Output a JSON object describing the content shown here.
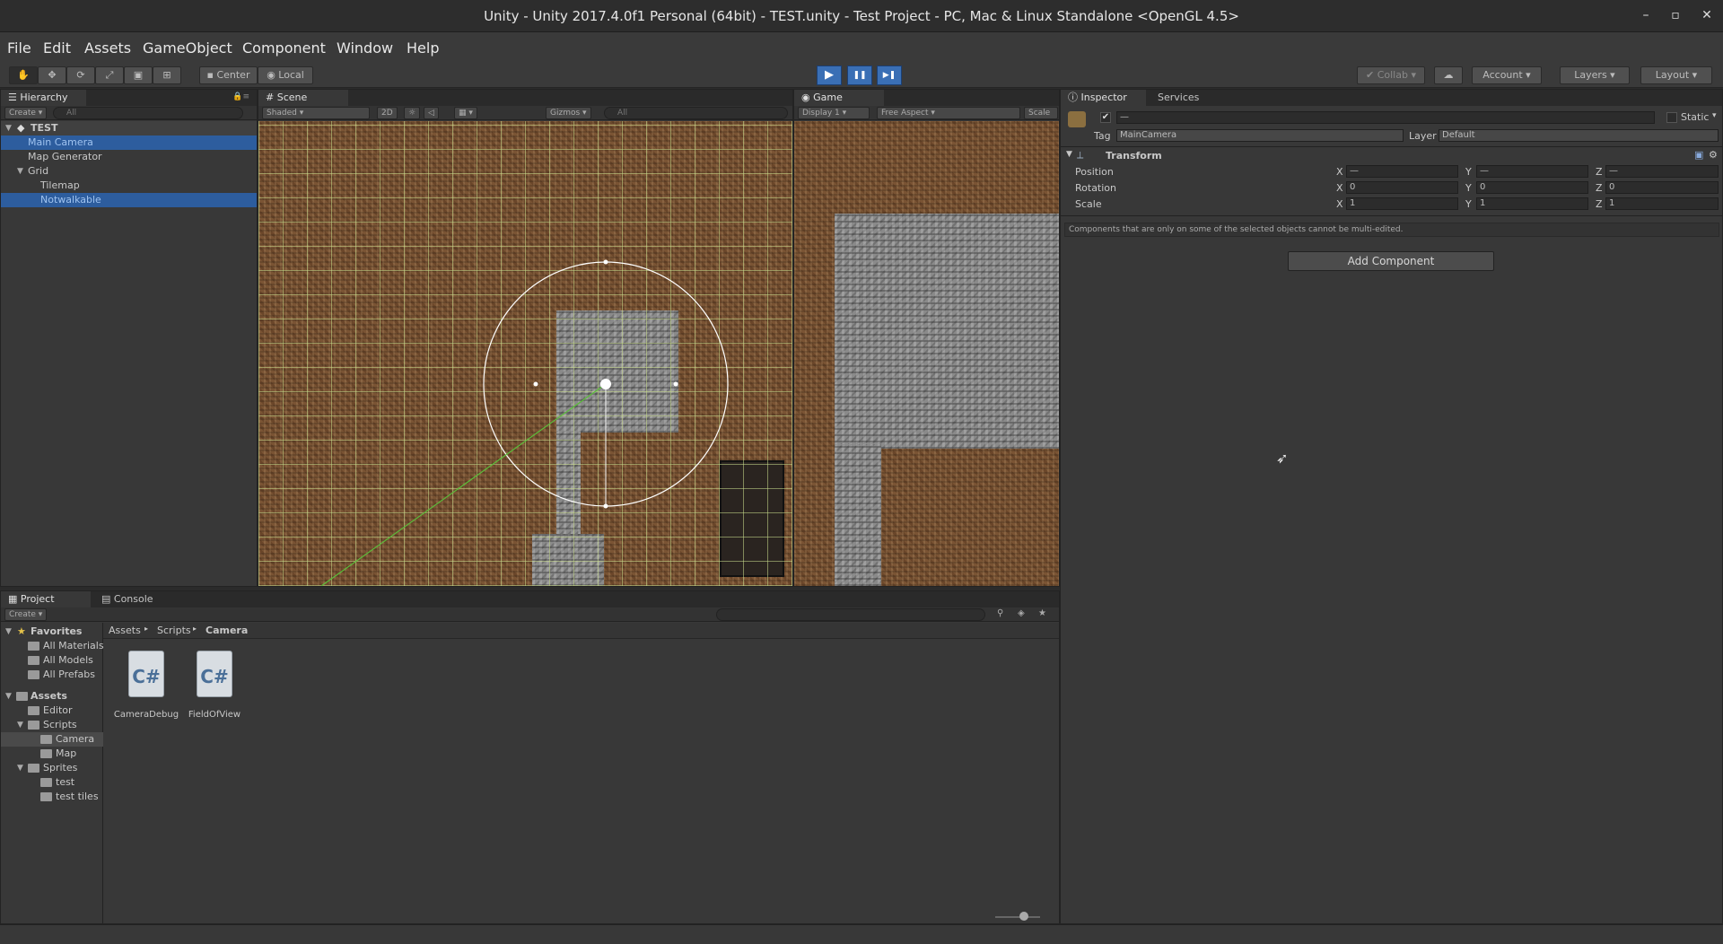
{
  "window": {
    "title": "Unity - Unity 2017.4.0f1 Personal (64bit) - TEST.unity - Test Project - PC, Mac & Linux Standalone <OpenGL 4.5>",
    "minimize": "–",
    "maximize": "▫",
    "close": "✕"
  },
  "menu": [
    "File",
    "Edit",
    "Assets",
    "GameObject",
    "Component",
    "Window",
    "Help"
  ],
  "toolbar": {
    "pivot": "Center",
    "space": "Local",
    "play": "▶",
    "pause": "❚❚",
    "step": "▶❚",
    "collab": "Collab",
    "account": "Account",
    "layers": "Layers",
    "layout": "Layout"
  },
  "hierarchy": {
    "tab": "Hierarchy",
    "create": "Create",
    "search_placeholder": "All",
    "scene": "TEST",
    "items": [
      {
        "label": "Main Camera",
        "selected": true
      },
      {
        "label": "Map Generator",
        "selected": false
      },
      {
        "label": "Grid",
        "selected": false
      },
      {
        "label": "Tilemap",
        "selected": false
      },
      {
        "label": "Notwalkable",
        "selected": true
      }
    ]
  },
  "scene": {
    "tab": "Scene",
    "shading": "Shaded",
    "mode2d": "2D",
    "gizmos": "Gizmos",
    "search_placeholder": "All"
  },
  "game": {
    "tab": "Game",
    "display": "Display 1",
    "aspect": "Free Aspect",
    "scale": "Scale"
  },
  "inspector": {
    "tab": "Inspector",
    "services_tab": "Services",
    "name_value": "—",
    "static_label": "Static",
    "tag_label": "Tag",
    "tag_value": "MainCamera",
    "layer_label": "Layer",
    "layer_value": "Default",
    "transform_title": "Transform",
    "position_label": "Position",
    "rotation_label": "Rotation",
    "scale_label": "Scale",
    "axes": [
      "X",
      "Y",
      "Z"
    ],
    "position": [
      "—",
      "—",
      "—"
    ],
    "rotation": [
      "0",
      "0",
      "0"
    ],
    "scale": [
      "1",
      "1",
      "1"
    ],
    "multi_edit_note": "Components that are only on some of the selected objects cannot be multi-edited.",
    "add_component": "Add Component"
  },
  "project": {
    "tab": "Project",
    "console_tab": "Console",
    "create": "Create",
    "breadcrumb": [
      "Assets",
      "Scripts",
      "Camera"
    ],
    "favorites_label": "Favorites",
    "favorites": [
      "All Materials",
      "All Models",
      "All Prefabs"
    ],
    "assets_label": "Assets",
    "tree": [
      {
        "label": "Editor",
        "level": 1,
        "selected": false
      },
      {
        "label": "Scripts",
        "level": 1,
        "selected": false
      },
      {
        "label": "Camera",
        "level": 2,
        "selected": true
      },
      {
        "label": "Map",
        "level": 2,
        "selected": false
      },
      {
        "label": "Sprites",
        "level": 1,
        "selected": false
      },
      {
        "label": "test",
        "level": 2,
        "selected": false
      },
      {
        "label": "test tiles",
        "level": 2,
        "selected": false
      }
    ],
    "files": [
      {
        "name": "CameraDebug",
        "icon": "C#"
      },
      {
        "name": "FieldOfView",
        "icon": "C#"
      }
    ]
  }
}
